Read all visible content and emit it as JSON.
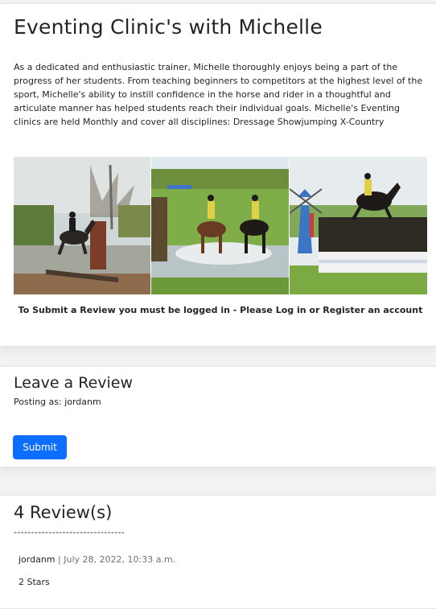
{
  "clinic": {
    "title": "Eventing Clinic's with Michelle",
    "description": "As a dedicated and enthusiastic trainer, Michelle thoroughly enjoys being a part of the progress of her students. From teaching beginners to competitors at the highest level of the sport, Michelle's ability to instill confidence in the horse and rider in a thoughtful and articulate manner has helped students reach their individual goals. Michelle's Eventing clinics are held Monthly and cover all disciplines: Dressage Showjumping X-Country",
    "login_notice": "To Submit a Review you must be logged in - Please Log in or Register an account"
  },
  "review_form": {
    "heading": "Leave a Review",
    "posting_as": "Posting as: jordanm",
    "submit_label": "Submit",
    "submit_color": "#0d6efd"
  },
  "reviews": {
    "count_label": "4 Review(s)",
    "divider": "--------------------------------",
    "items": [
      {
        "author": "jordanm",
        "separator": "|",
        "date": "July 28, 2022, 10:33 a.m.",
        "rating": "2 Stars"
      }
    ]
  }
}
